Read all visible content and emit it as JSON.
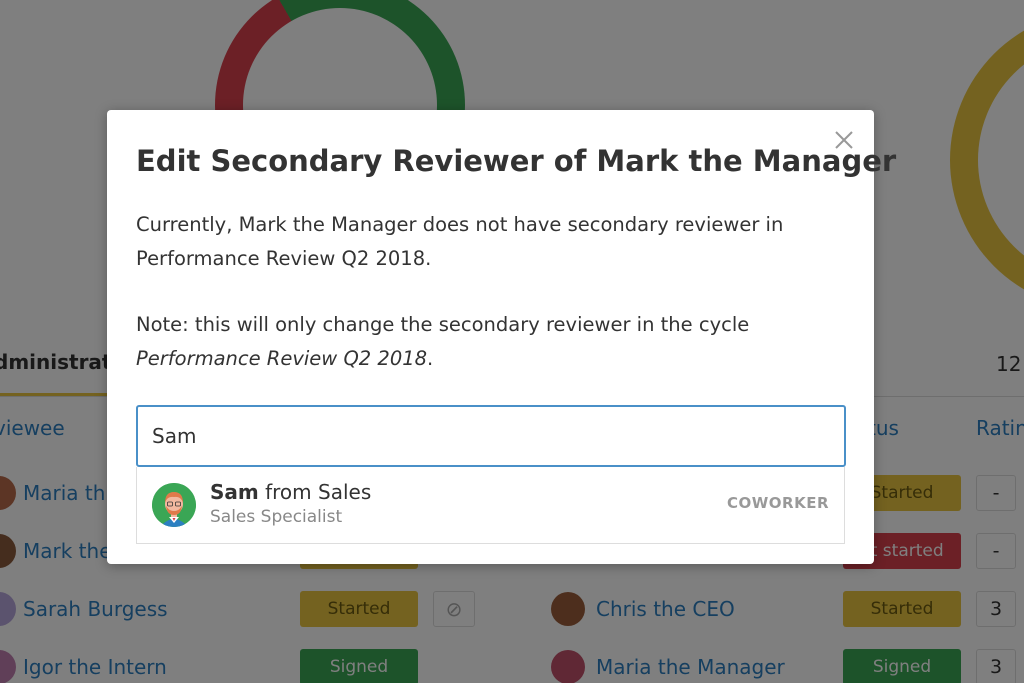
{
  "background": {
    "tab": "dministratio",
    "count": "12",
    "columns": {
      "reviewee": "viewee",
      "status": "tus",
      "rating": "Ratin"
    },
    "rows": [
      {
        "reviewee": "Maria th",
        "status": "Started",
        "rating": "-"
      },
      {
        "reviewee": "Mark the",
        "status": "ot started",
        "rating": "-"
      },
      {
        "reviewee": "Sarah Burgess",
        "reviewee_status": "Started",
        "reviewer": "Chris the CEO",
        "status": "Started",
        "rating": "3"
      },
      {
        "reviewee": "Igor the Intern",
        "reviewee_status": "Signed",
        "reviewer": "Maria the Manager",
        "status": "Signed",
        "rating": "3"
      }
    ],
    "colors": {
      "green": "#3aa655",
      "yellow": "#e8c440",
      "red": "#d9404c",
      "link": "#2c7fc1"
    }
  },
  "modal": {
    "title": "Edit Secondary Reviewer of Mark the Manager",
    "paragraph1_line1": "Currently, Mark the Manager does not have secondary reviewer in",
    "paragraph1_line2": "Performance Review Q2 2018.",
    "paragraph2_line1": "Note: this will only change the secondary reviewer in the cycle",
    "paragraph2_cycle": "Performance Review Q2 2018",
    "paragraph2_end": ".",
    "close_icon": "close-icon",
    "search": {
      "value": "Sam"
    },
    "result": {
      "name_bold": "Sam",
      "name_rest": " from Sales",
      "title": "Sales Specialist",
      "tag": "COWORKER",
      "avatar_icon": "person-avatar-icon"
    }
  }
}
